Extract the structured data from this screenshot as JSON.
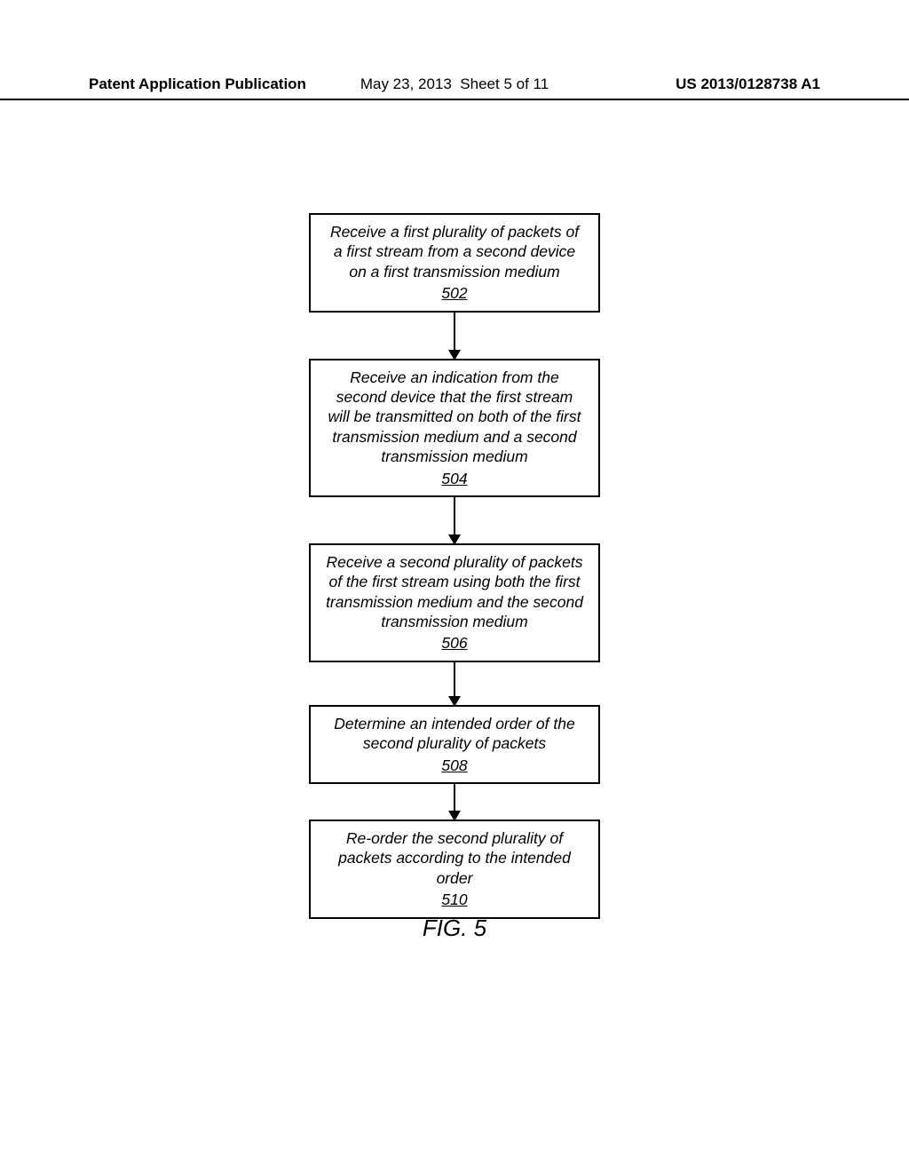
{
  "header": {
    "left": "Patent Application Publication",
    "date": "May 23, 2013",
    "sheet": "Sheet 5 of 11",
    "pubno": "US 2013/0128738 A1"
  },
  "flowchart": {
    "steps": [
      {
        "text": "Receive a first plurality of packets of a first stream from a second device on a first transmission medium",
        "ref": "502",
        "arrow": "arrow-52"
      },
      {
        "text": "Receive an indication from the second device that the first stream will be transmitted on both of the first transmission medium and a second transmission medium",
        "ref": "504",
        "arrow": "arrow-52"
      },
      {
        "text": "Receive a second plurality of packets of the first stream using both the first transmission medium and the second transmission medium",
        "ref": "506",
        "arrow": "arrow-48"
      },
      {
        "text": "Determine an intended order of the second plurality of packets",
        "ref": "508",
        "arrow": "arrow-40"
      },
      {
        "text": "Re-order the second plurality of packets according to the intended order",
        "ref": "510",
        "arrow": null
      }
    ]
  },
  "figure_label": "FIG. 5"
}
